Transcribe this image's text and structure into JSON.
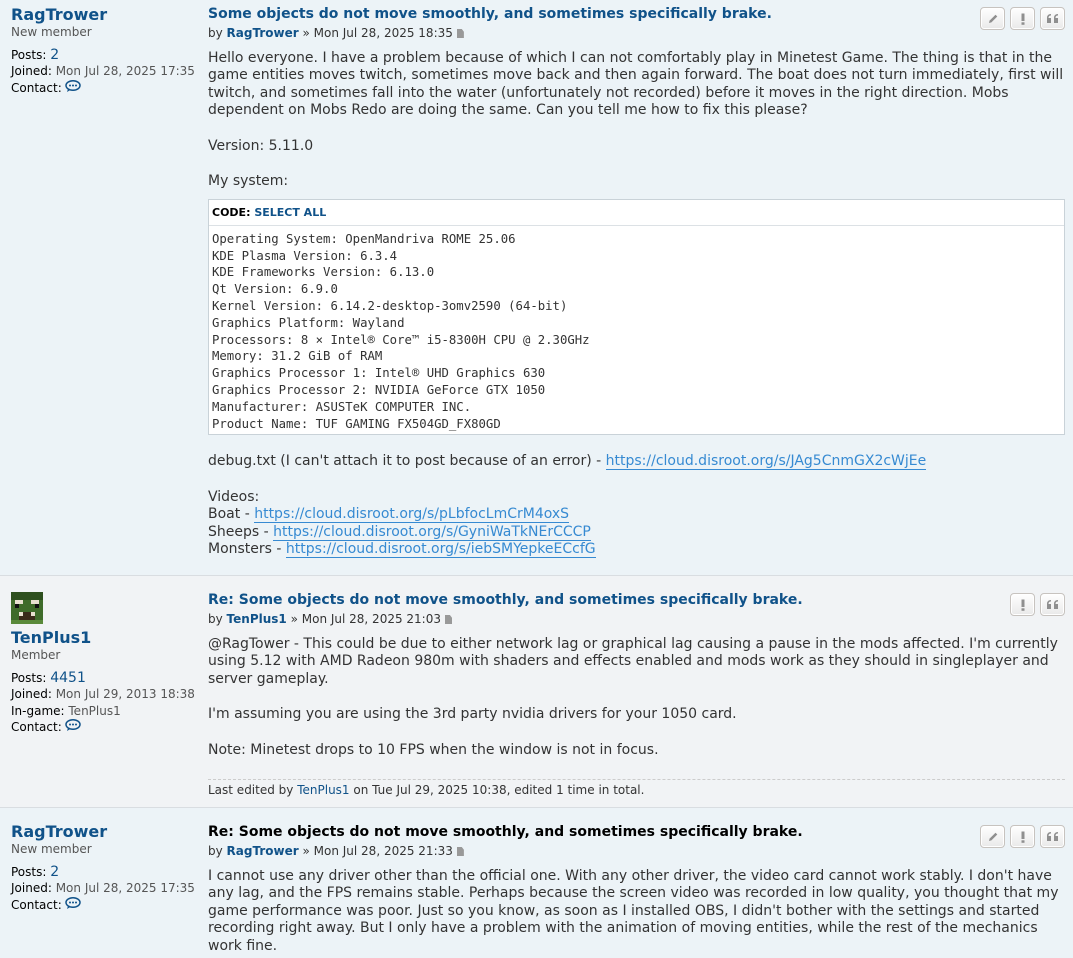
{
  "colors": {
    "link": "#105289",
    "url": "#368AD2",
    "bg_post1": "#ECF3F7",
    "bg_post2": "#F1F3F5"
  },
  "posts": [
    {
      "username": "RagTrower",
      "rank": "New member",
      "posts_label": "Posts:",
      "posts_count": "2",
      "joined_label": "Joined:",
      "joined": "Mon Jul 28, 2025 17:35",
      "contact_label": "Contact:",
      "title": "Some objects do not move smoothly, and sometimes specifically brake.",
      "by": "by",
      "author": "RagTrower",
      "date": "» Mon Jul 28, 2025 18:35",
      "para1": "Hello everyone. I have a problem because of which I can not comfortably play in Minetest Game. The thing is that in the game entities moves twitch, sometimes move back and then again forward. The boat does not turn immediately, first will twitch, and sometimes fall into the water (unfortunately not recorded) before it moves in the right direction. Mobs dependent on Mobs Redo are doing the same. Can you tell me how to fix this please?",
      "version": "Version: 5.11.0",
      "my_system": "My system:",
      "code_label": "CODE:",
      "select_all": "SELECT ALL",
      "code": "Operating System: OpenMandriva ROME 25.06\nKDE Plasma Version: 6.3.4\nKDE Frameworks Version: 6.13.0\nQt Version: 6.9.0\nKernel Version: 6.14.2-desktop-3omv2590 (64-bit)\nGraphics Platform: Wayland\nProcessors: 8 × Intel® Core™ i5-8300H CPU @ 2.30GHz\nMemory: 31.2 GiB of RAM\nGraphics Processor 1: Intel® UHD Graphics 630\nGraphics Processor 2: NVIDIA GeForce GTX 1050\nManufacturer: ASUSTeK COMPUTER INC.\nProduct Name: TUF GAMING FX504GD_FX80GD",
      "debug_text": "debug.txt (I can't attach it to post because of an error) - ",
      "debug_url": "https://cloud.disroot.org/s/JAg5CnmGX2cWjEe",
      "videos": "Videos:",
      "boat_label": "Boat - ",
      "boat_url": "https://cloud.disroot.org/s/pLbfocLmCrM4oxS",
      "sheeps_label": "Sheeps - ",
      "sheeps_url": "https://cloud.disroot.org/s/GyniWaTkNErCCCP",
      "monsters_label": "Monsters - ",
      "monsters_url": "https://cloud.disroot.org/s/iebSMYepkeECcfG"
    },
    {
      "username": "TenPlus1",
      "rank": "Member",
      "posts_label": "Posts:",
      "posts_count": "4451",
      "joined_label": "Joined:",
      "joined": "Mon Jul 29, 2013 18:38",
      "ingame_label": "In-game:",
      "ingame": "TenPlus1",
      "contact_label": "Contact:",
      "title": "Re: Some objects do not move smoothly, and sometimes specifically brake.",
      "by": "by",
      "author": "TenPlus1",
      "date": "» Mon Jul 28, 2025 21:03",
      "para1": "@RagTower - This could be due to either network lag or graphical lag causing a pause in the mods affected. I'm currently using 5.12 with AMD Radeon 980m with shaders and effects enabled and mods work as they should in singleplayer and server gameplay.",
      "para2": "I'm assuming you are using the 3rd party nvidia drivers for your 1050 card.",
      "para3": "Note: Minetest drops to 10 FPS when the window is not in focus.",
      "edited_prefix": "Last edited by",
      "edited_user": "TenPlus1",
      "edited_suffix": "on Tue Jul 29, 2025 10:38, edited 1 time in total."
    },
    {
      "username": "RagTrower",
      "rank": "New member",
      "posts_label": "Posts:",
      "posts_count": "2",
      "joined_label": "Joined:",
      "joined": "Mon Jul 28, 2025 17:35",
      "contact_label": "Contact:",
      "title": "Re: Some objects do not move smoothly, and sometimes specifically brake.",
      "by": "by",
      "author": "RagTrower",
      "date": "» Mon Jul 28, 2025 21:33",
      "para1": "I cannot use any driver other than the official one. With any other driver, the video card cannot work stably. I don't have any lag, and the FPS remains stable. Perhaps because the screen video was recorded in low quality, you thought that my game performance was poor. Just so you know, as soon as I installed OBS, I didn't bother with the settings and started recording right away. But I only have a problem with the animation of moving entities, while the rest of the mechanics work fine."
    }
  ]
}
